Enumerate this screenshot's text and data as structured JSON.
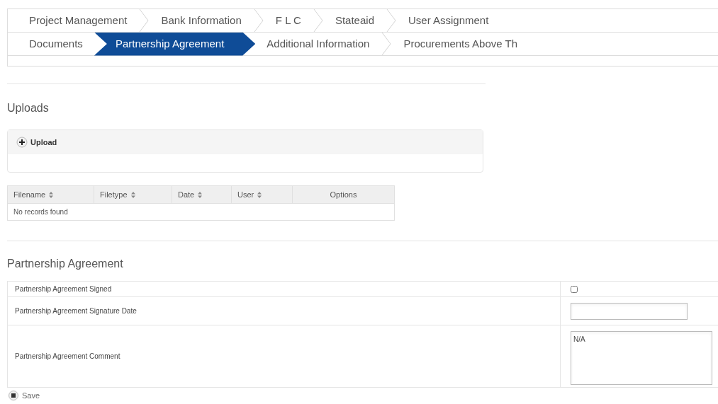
{
  "tab_rows": [
    {
      "tabs": [
        {
          "label": "Project Management",
          "selected": false
        },
        {
          "label": "Bank Information",
          "selected": false
        },
        {
          "label": "F L C",
          "selected": false
        },
        {
          "label": "Stateaid",
          "selected": false
        },
        {
          "label": "User Assignment",
          "selected": false
        }
      ]
    },
    {
      "tabs": [
        {
          "label": "Documents",
          "selected": false
        },
        {
          "label": "Partnership Agreement",
          "selected": true
        },
        {
          "label": "Additional Information",
          "selected": false
        },
        {
          "label": "Procurements Above Th",
          "selected": false
        }
      ]
    }
  ],
  "uploads": {
    "heading": "Uploads",
    "upload_button": "Upload",
    "table": {
      "columns": [
        {
          "label": "Filename",
          "sortable": true
        },
        {
          "label": "Filetype",
          "sortable": true
        },
        {
          "label": "Date",
          "sortable": true
        },
        {
          "label": "User",
          "sortable": true
        },
        {
          "label": "Options",
          "sortable": false
        }
      ],
      "empty_message": "No records found"
    }
  },
  "agreement": {
    "heading": "Partnership Agreement",
    "fields": [
      {
        "label": "Partnership Agreement Signed",
        "kind": "checkbox",
        "checked": false
      },
      {
        "label": "Partnership Agreement Signature Date",
        "kind": "date"
      },
      {
        "label": "Partnership Agreement Comment",
        "kind": "textarea",
        "value": "N/A"
      }
    ],
    "save_button": "Save"
  }
}
